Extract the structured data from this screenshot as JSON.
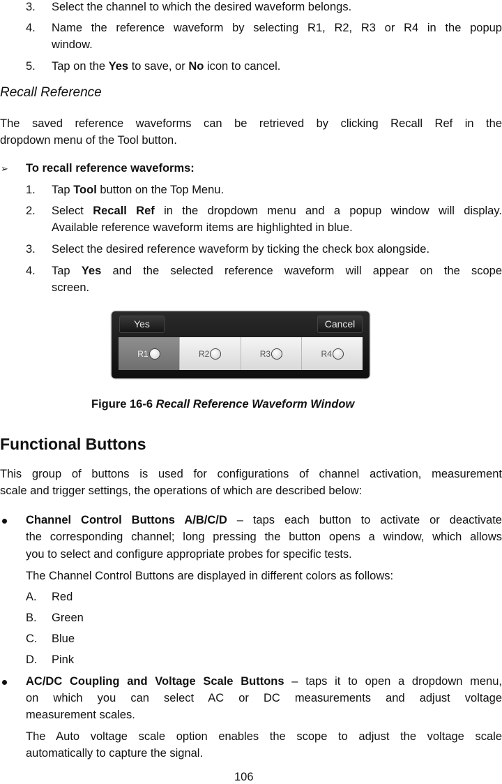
{
  "steps_save": [
    {
      "num": "3.",
      "text": "Select the channel to which the desired waveform belongs."
    },
    {
      "num": "4.",
      "line1": "Name the reference waveform by selecting R1, R2, R3 or R4 in the popup",
      "line2": "window."
    },
    {
      "num": "5.",
      "pre": "Tap on the ",
      "b1": "Yes",
      "mid": " to save, or ",
      "b2": "No",
      "post": " icon to cancel."
    }
  ],
  "recall_section": {
    "title": "Recall Reference",
    "para_line1": "The saved reference waveforms can be retrieved by clicking Recall Ref in the",
    "para_line2": "dropdown menu of the Tool button.",
    "procedure_title": "To recall reference waveforms:",
    "steps": [
      {
        "num": "1.",
        "pre": "Tap ",
        "bold": "Tool",
        "post": " button on the Top Menu."
      },
      {
        "num": "2.",
        "pre": "Select ",
        "bold": "Recall Ref",
        "post": " in the dropdown menu and a popup window will display.",
        "line2": "Available reference waveform items are highlighted in blue."
      },
      {
        "num": "3.",
        "text": "Select the desired reference waveform by ticking the check box alongside."
      },
      {
        "num": "4.",
        "pre": "Tap ",
        "bold": "Yes",
        "post": " and the selected reference waveform will appear on the scope",
        "line2": "screen."
      }
    ]
  },
  "dialog": {
    "yes_label": "Yes",
    "cancel_label": "Cancel",
    "refs": [
      {
        "label": "R1",
        "selected": true
      },
      {
        "label": "R2",
        "selected": false
      },
      {
        "label": "R3",
        "selected": false
      },
      {
        "label": "R4",
        "selected": false
      }
    ]
  },
  "figure_caption": {
    "number": "Figure 16-6",
    "title": "Recall Reference Waveform Window"
  },
  "functional": {
    "title": "Functional Buttons",
    "intro_line1": "This group of buttons is used for configurations of channel activation, measurement",
    "intro_line2": "scale and trigger settings, the operations of which are described below:",
    "channel": {
      "bold": "Channel Control Buttons A/B/C/D",
      "line1_rest": " – taps each button to activate or deactivate",
      "line2": "the corresponding channel; long pressing the button opens a window, which allows",
      "line3": "you to select and configure appropriate probes for specific tests.",
      "colors_intro": "The Channel Control Buttons are displayed in different colors as follows:",
      "colors": [
        {
          "letter": "A.",
          "name": "Red"
        },
        {
          "letter": "B.",
          "name": "Green"
        },
        {
          "letter": "C.",
          "name": "Blue"
        },
        {
          "letter": "D.",
          "name": "Pink"
        }
      ]
    },
    "acdc": {
      "bold": "AC/DC Coupling and Voltage Scale Buttons",
      "line1_rest": " – taps it to open a dropdown menu,",
      "line2": "on which you can select AC or DC measurements and adjust voltage",
      "line3": "measurement scales.",
      "auto_line1": "The Auto voltage scale option enables the scope to adjust the voltage scale",
      "auto_line2": "automatically to capture the signal."
    }
  },
  "page_number": "106"
}
